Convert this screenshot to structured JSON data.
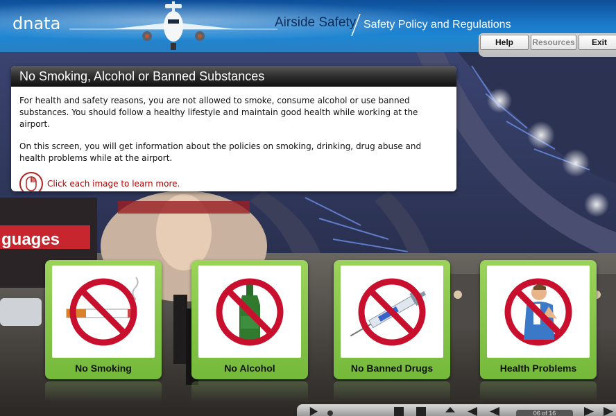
{
  "header": {
    "logo": "dnata",
    "course_title": "Airside Safety",
    "module_title": "Safety Policy and Regulations",
    "buttons": {
      "help": "Help",
      "resources": "Resources",
      "exit": "Exit"
    }
  },
  "panel": {
    "title": "No Smoking, Alcohol or Banned Substances",
    "paragraph1": "For health and safety reasons, you are not allowed to smoke, consume alcohol or use banned substances. You should follow a healthy lifestyle and maintain good health while working at the airport.",
    "paragraph2": "On this screen, you will get information about the policies on smoking, drinking, drug abuse and health problems while at the airport.",
    "hint": "Click each image to learn more."
  },
  "background": {
    "sign_text": "guages"
  },
  "cards": [
    {
      "label": "No Smoking",
      "icon": "no-smoking-icon"
    },
    {
      "label": "No Alcohol",
      "icon": "no-alcohol-icon"
    },
    {
      "label": "No Banned Drugs",
      "icon": "no-drugs-icon"
    },
    {
      "label": "Health Problems",
      "icon": "health-problems-icon"
    }
  ],
  "controls": {
    "page_counter": "06 of 16"
  },
  "colors": {
    "header_blue": "#1a78c8",
    "card_green": "#8cc84b",
    "prohibit_red": "#c8102e",
    "hint_red": "#b00000"
  }
}
